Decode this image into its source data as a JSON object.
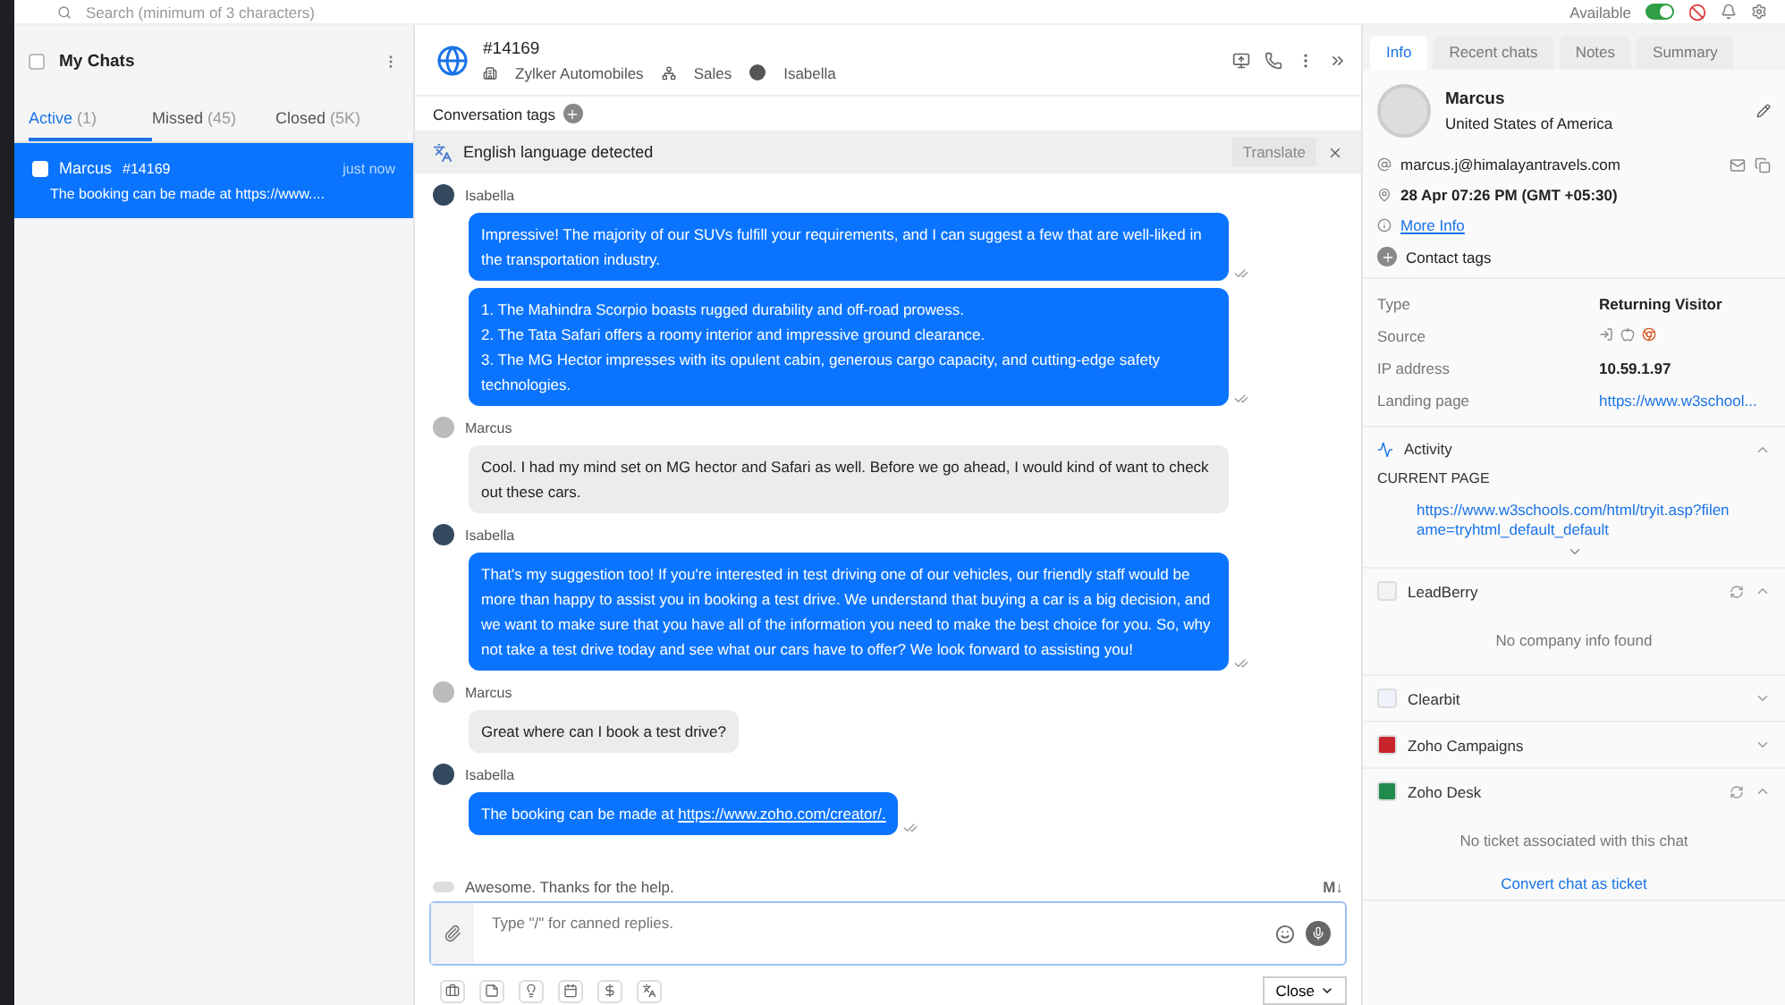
{
  "topbar": {
    "search_placeholder": "Search (minimum of 3 characters)",
    "availability": {
      "label": "Available",
      "on": true
    }
  },
  "chat_list": {
    "title": "My Chats",
    "select_all_checked": false,
    "tabs": [
      {
        "label": "Active",
        "count": "(1)",
        "selected": true
      },
      {
        "label": "Missed",
        "count": "(45)",
        "selected": false
      },
      {
        "label": "Closed",
        "count": "(5K)",
        "selected": false
      }
    ],
    "items": [
      {
        "name": "Marcus",
        "id": "#14169",
        "time": "just now",
        "preview": "The booking can be made at https://www....",
        "selected": true,
        "checked": false
      }
    ]
  },
  "conversation": {
    "id": "#14169",
    "company": "Zylker Automobiles",
    "department": "Sales",
    "agent": "Isabella",
    "tags_label": "Conversation tags",
    "language_bar": {
      "text": "English language detected",
      "button": "Translate"
    },
    "messages": [
      {
        "sender": "Isabella",
        "kind": "agent",
        "bubbles": [
          {
            "lines": [
              "Impressive! The majority of our SUVs fulfill your requirements, and I can suggest a few that are well-liked in the transportation industry."
            ]
          },
          {
            "lines": [
              "1. The Mahindra Scorpio boasts rugged durability and off-road prowess.",
              "2. The Tata Safari offers a roomy interior and impressive ground clearance.",
              "3. The MG Hector impresses with its opulent cabin, generous cargo capacity, and cutting-edge safety technologies."
            ]
          }
        ]
      },
      {
        "sender": "Marcus",
        "kind": "visitor",
        "bubbles": [
          {
            "lines": [
              "Cool. I had my mind set on MG hector and Safari as well. Before we go ahead, I would kind of want to check out these cars."
            ]
          }
        ]
      },
      {
        "sender": "Isabella",
        "kind": "agent",
        "bubbles": [
          {
            "lines": [
              "That's my suggestion too! If you're interested in test driving one of our vehicles, our friendly staff would be more than happy to assist you in booking a test drive. We understand that buying a car is a big decision, and we want to make sure that you have all of the information you need to make the best choice for you. So, why not take a test drive today and see what our cars have to offer? We look forward to assisting you!"
            ]
          }
        ]
      },
      {
        "sender": "Marcus",
        "kind": "visitor",
        "bubbles": [
          {
            "lines": [
              "Great where can I book a test drive?"
            ]
          }
        ]
      },
      {
        "sender": "Isabella",
        "kind": "agent",
        "bubbles": [
          {
            "lines": [
              "The booking can be made at "
            ],
            "link": "https://www.zoho.com/creator/."
          }
        ]
      }
    ],
    "typing": "Awesome. Thanks for the help.",
    "markdown": "M↓",
    "composer_placeholder": "Type \"/\" for canned replies.",
    "close_button": "Close"
  },
  "visitor": {
    "tabs": [
      {
        "label": "Info",
        "selected": true
      },
      {
        "label": "Recent chats",
        "selected": false
      },
      {
        "label": "Notes",
        "selected": false
      },
      {
        "label": "Summary",
        "selected": false
      }
    ],
    "name": "Marcus",
    "country": "United States of America",
    "email": "marcus.j@himalayantravels.com",
    "local_time": "28 Apr 07:26 PM  (GMT +05:30)",
    "more_info": "More Info",
    "contact_tags": "Contact tags",
    "details": [
      {
        "label": "Type",
        "value": "Returning Visitor",
        "kind": "text"
      },
      {
        "label": "Source",
        "kind": "icons"
      },
      {
        "label": "IP address",
        "value": "10.59.1.97",
        "kind": "text"
      },
      {
        "label": "Landing page",
        "value": "https://www.w3school...",
        "kind": "link"
      }
    ],
    "activity": {
      "title": "Activity",
      "current_page_label": "CURRENT PAGE",
      "url": "https://www.w3schools.com/html/tryit.asp?filename=tryhtml_default_default",
      "expanded": true
    },
    "integrations": [
      {
        "name": "LeadBerry",
        "color": "#f3f3f3",
        "expanded": true,
        "refresh": true,
        "empty": "No company info found"
      },
      {
        "name": "Clearbit",
        "color": "#eef3fb",
        "expanded": false,
        "refresh": false
      },
      {
        "name": "Zoho Campaigns",
        "color": "#c8242b",
        "expanded": false,
        "refresh": false
      },
      {
        "name": "Zoho Desk",
        "color": "#1f8a4c",
        "expanded": true,
        "refresh": true,
        "empty": "No ticket associated with this chat",
        "action": "Convert chat as ticket"
      }
    ]
  }
}
